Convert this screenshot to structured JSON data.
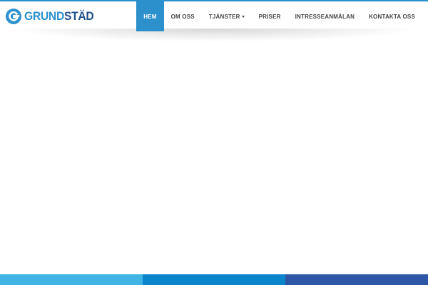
{
  "brand": {
    "logo_part_a": "GRUND",
    "logo_part_b": "STÄD",
    "logo_icon": "g-letter-circle-icon",
    "primary_color": "#2b90cc",
    "dark_color": "#1d4f8a"
  },
  "nav": {
    "items": [
      {
        "label": "HEM",
        "active": true
      },
      {
        "label": "OM OSS",
        "active": false
      },
      {
        "label": "TJÄNSTER",
        "active": false,
        "has_dropdown": true
      },
      {
        "label": "PRISER",
        "active": false
      },
      {
        "label": "INTRESSEANMÄLAN",
        "active": false
      },
      {
        "label": "KONTAKTA OSS",
        "active": false
      }
    ],
    "dropdown_icon": "caret-down-icon"
  },
  "footer": {
    "bar_colors": [
      "#41b4e6",
      "#0a85cc",
      "#2d57a6"
    ]
  }
}
